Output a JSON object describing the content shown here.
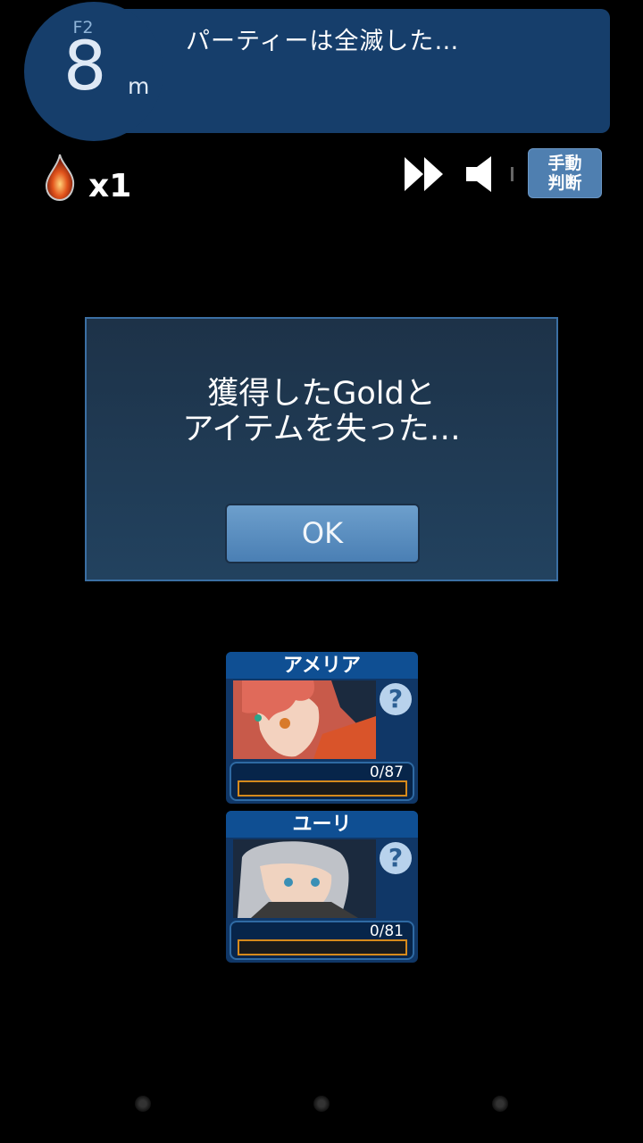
{
  "header": {
    "floor_label": "F2",
    "distance_value": "8",
    "distance_unit": "m",
    "message": "パーティーは全滅した…"
  },
  "status": {
    "item_icon": "flame-gem-icon",
    "item_count": "x1"
  },
  "controls": {
    "fast_forward_icon": "fast-forward-icon",
    "sound_icon": "speaker-icon",
    "manual_label_line1": "手動",
    "manual_label_line2": "判断"
  },
  "dialog": {
    "line1": "獲得したGoldと",
    "line2": "アイテムを失った…",
    "ok_label": "OK"
  },
  "party": [
    {
      "name": "アメリア",
      "hp_text": "0/87",
      "hp_fraction": 0,
      "help": "?"
    },
    {
      "name": "ユーリ",
      "hp_text": "0/81",
      "hp_fraction": 0,
      "help": "?"
    }
  ],
  "colors": {
    "header_bg": "#163e6b",
    "dialog_border": "#3b6fa3",
    "button": "#5b8fc2",
    "hp_border": "#d68a1c"
  }
}
